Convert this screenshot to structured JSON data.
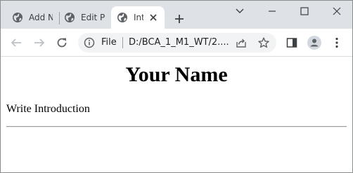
{
  "browser": {
    "tabs": [
      {
        "title": "Add N",
        "active": false,
        "icon": "globe-icon"
      },
      {
        "title": "Edit Pc",
        "active": false,
        "icon": "globe-icon"
      },
      {
        "title": "Int",
        "active": true,
        "icon": "globe-icon"
      }
    ],
    "new_tab_icon": "plus-icon",
    "window_controls": [
      "chevron-down-icon",
      "minimize-icon",
      "maximize-icon",
      "close-icon"
    ],
    "toolbar": {
      "icons": [
        "back-arrow-icon",
        "forward-arrow-icon",
        "reload-icon",
        "side-panel-icon",
        "profile-icon",
        "kebab-menu-icon"
      ],
      "omnibox": {
        "scheme_label": "File",
        "url": "D:/BCA_1_M1_WT/2....",
        "icons": [
          "info-icon",
          "share-icon",
          "star-icon"
        ]
      }
    },
    "colors": {
      "tabstrip_bg": "#dee1e6",
      "omnibox_bg": "#f1f3f4",
      "icon": "#5f6368"
    }
  },
  "page": {
    "title": "Your Name",
    "introduction": "Write Introduction"
  }
}
